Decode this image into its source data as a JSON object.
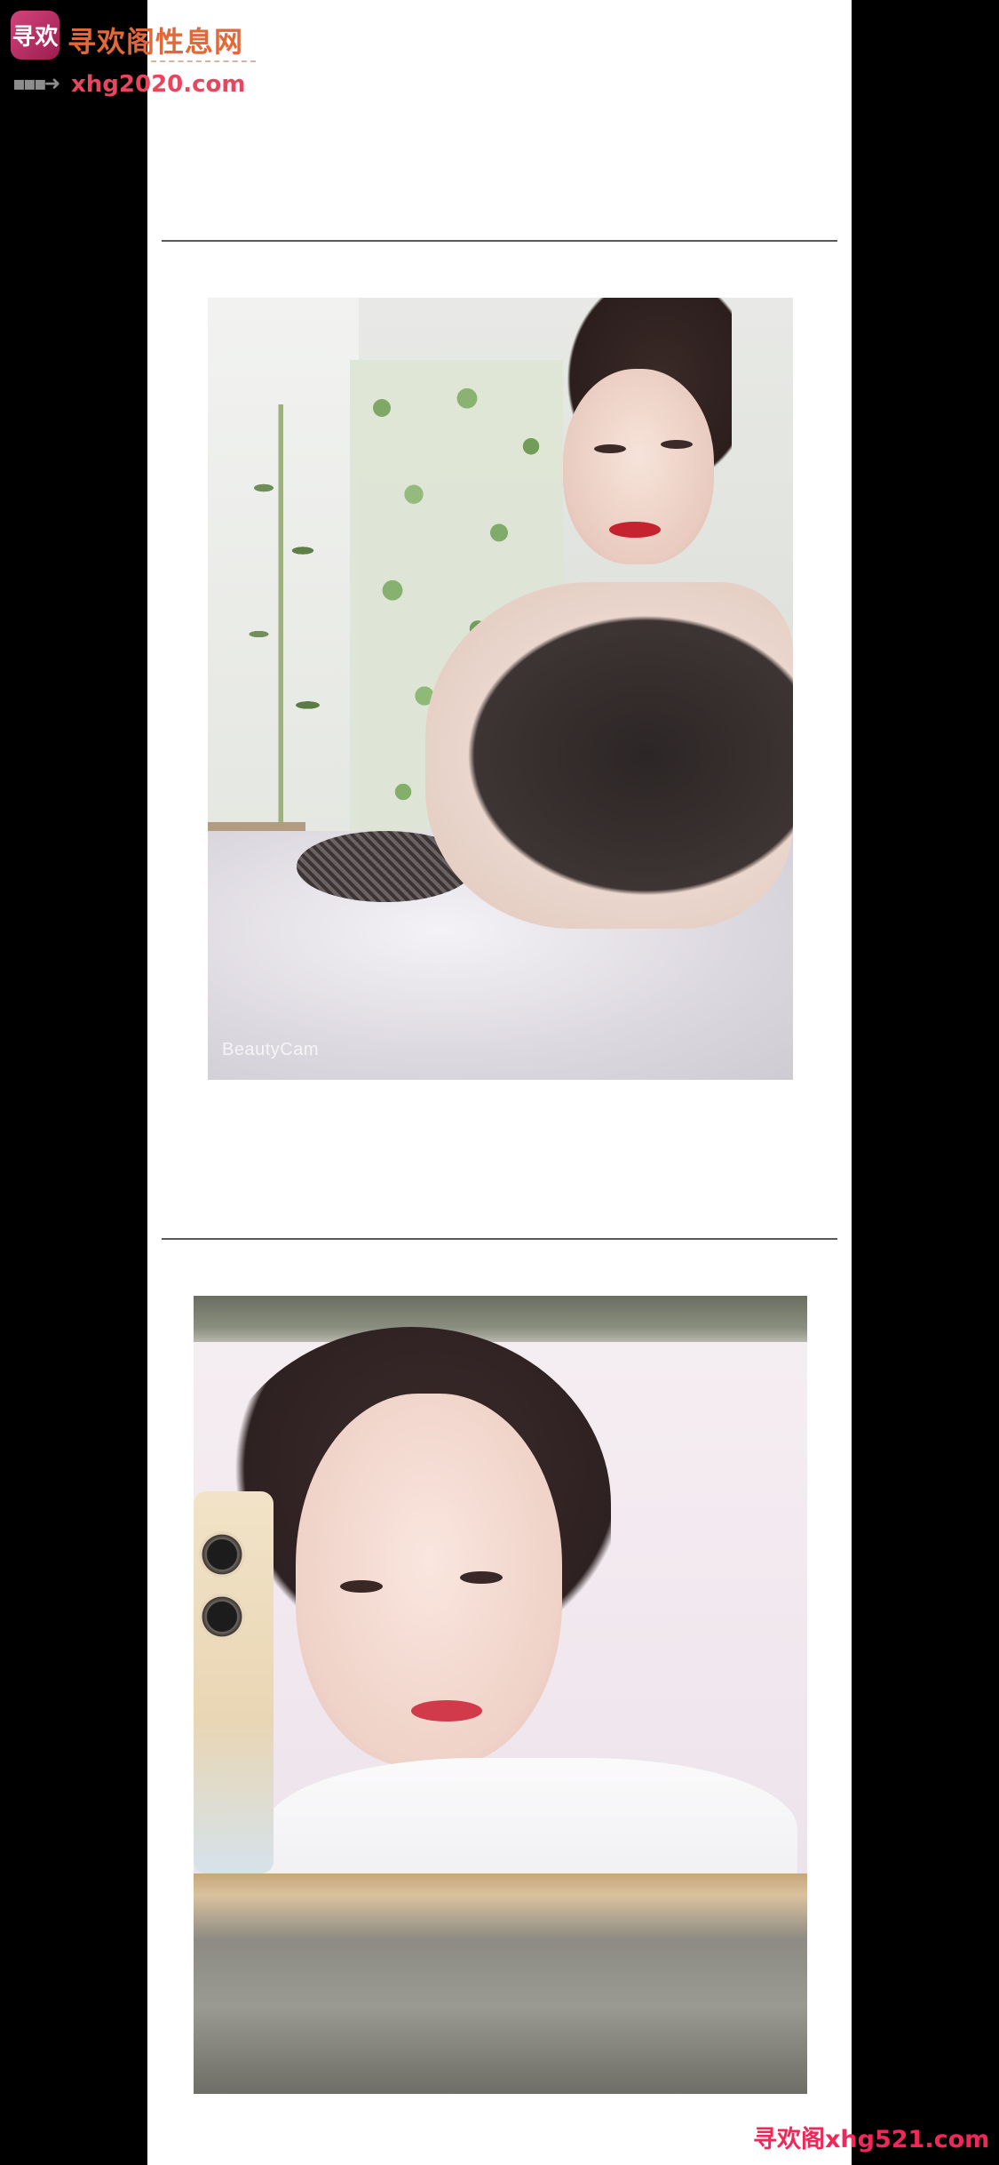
{
  "logo": {
    "mark_text": "寻欢",
    "title": "寻欢阁性息网",
    "url": "xhg2020.com"
  },
  "photo1": {
    "watermark": "BeautyCam"
  },
  "footer": {
    "watermark": "寻欢阁xhg521.com"
  },
  "colors": {
    "page_bg": "#000000",
    "content_bg": "#ffffff",
    "divider": "#5a5a5a",
    "logo_orange": "#e2683a",
    "logo_pink": "#e7465e",
    "footer_red": "#f0285a"
  }
}
